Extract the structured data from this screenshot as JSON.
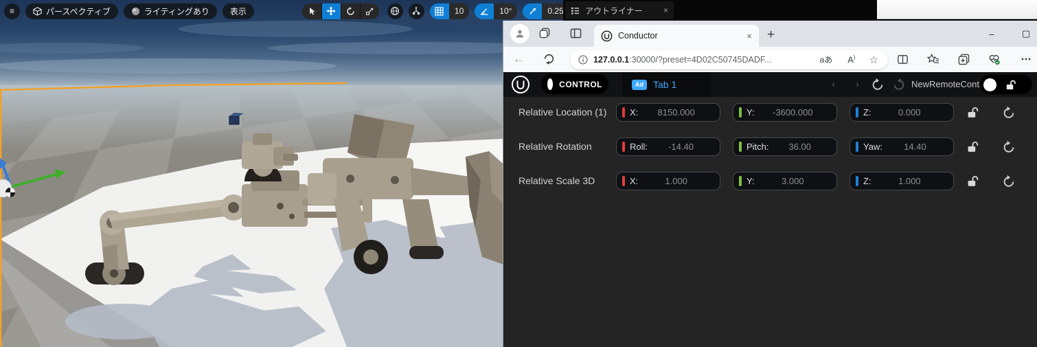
{
  "unreal": {
    "viewport_toolbar": {
      "menu_glyph": "≡",
      "perspective_label": "パースペクティブ",
      "lit_label": "ライティングあり",
      "show_label": "表示",
      "grid_snap_value": "10",
      "angle_snap_value": "10°",
      "scale_snap_value": "0.25",
      "overflow_glyph": "»"
    },
    "outliner_tab": {
      "label": "アウトライナー",
      "close_glyph": "×"
    }
  },
  "browser": {
    "tab": {
      "title": "Conductor",
      "close_glyph": "×",
      "new_tab_glyph": "+"
    },
    "address": {
      "host": "127.0.0.1",
      "rest": ":30000/?preset=4D02C50745DADF...",
      "translate_glyph": "aあ",
      "read_aloud_glyph": "A"
    },
    "window": {
      "minimize_glyph": "–",
      "maximize_glyph": "▢"
    }
  },
  "panel": {
    "control_label": "CONTROL",
    "tab_badge": "Ad",
    "tab_label": "Tab 1",
    "back_glyph": "‹",
    "forward_glyph": "›",
    "preset_name": "NewRemoteCont...",
    "colors": {
      "x": "#e23c3c",
      "y": "#7dc142",
      "z": "#1f7fd6",
      "accent": "#3fa9ff"
    },
    "rows": [
      {
        "label": "Relative Location (1)",
        "fields": [
          {
            "name": "X:",
            "value": "8150.000"
          },
          {
            "name": "Y:",
            "value": "-3600.000"
          },
          {
            "name": "Z:",
            "value": "0.000"
          }
        ]
      },
      {
        "label": "Relative Rotation",
        "fields": [
          {
            "name": "Roll:",
            "value": "-14.40"
          },
          {
            "name": "Pitch:",
            "value": "36.00"
          },
          {
            "name": "Yaw:",
            "value": "14.40"
          }
        ]
      },
      {
        "label": "Relative Scale 3D",
        "fields": [
          {
            "name": "X:",
            "value": "1.000"
          },
          {
            "name": "Y:",
            "value": "3.000"
          },
          {
            "name": "Z:",
            "value": "1.000"
          }
        ]
      }
    ]
  }
}
